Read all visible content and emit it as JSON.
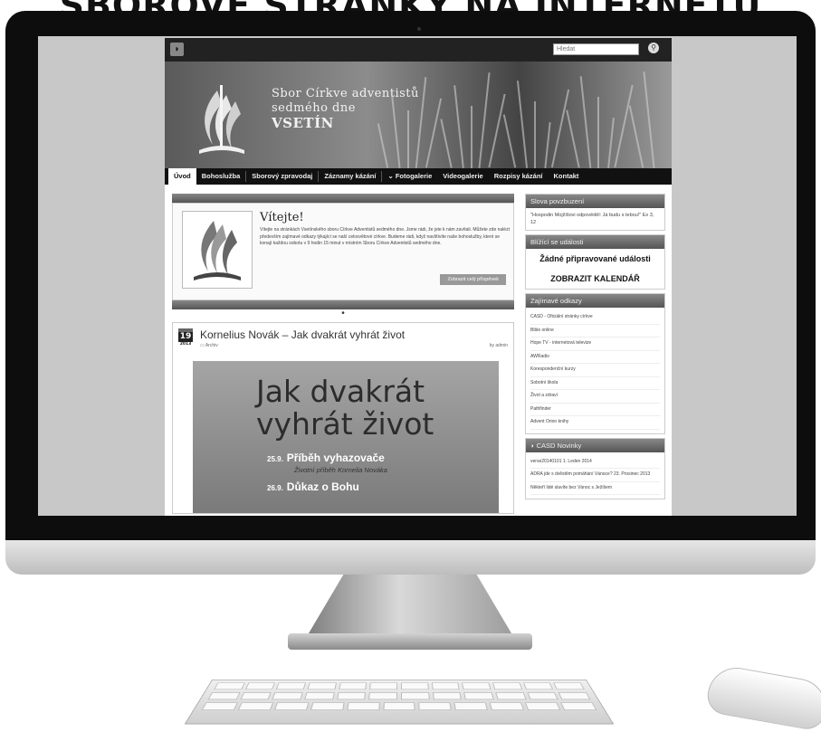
{
  "headline": "SBOROVÉ STRÁNKY NA INTERNETU",
  "site": {
    "search_placeholder": "Hledat",
    "church_line1": "Sbor Církve adventistů",
    "church_line2": "sedmého dne",
    "church_line3": "VSETÍN",
    "nav": [
      "Úvod",
      "Bohoslužba",
      "Sborový zpravodaj",
      "Záznamy kázání",
      "⌄ Fotogalerie",
      "Videogalerie",
      "Rozpisy kázání",
      "Kontakt"
    ],
    "welcome_title": "Vítejte!",
    "welcome_text": "Vítejte na stránkách Vsetínského sboru Církve Adventistů sedmého dne. Jsme rádi, že jste k nám zavítali. Můžete zde nalézt především zajímavé odkazy týkající se naší celosvětové církve. Budeme rádi, když navštívíte naše bohoslužby, které se konají každou sobotu v 9 hodin 15 minut v místním Sboru Církve Adventistů sedmého dne.",
    "welcome_button": "Zobrazit celý příspěvek",
    "post_day": "19",
    "post_year": "2013",
    "post_title": "Kornelius Novák – Jak dvakrát vyhrát život",
    "post_category": "Archiv",
    "post_author": "by admin",
    "poster_line1": "Jak dvakrát",
    "poster_line2": "vyhrát život",
    "poster_row1_date": "25.9.",
    "poster_row1_title": "Příběh vyhazovače",
    "poster_row1_sub": "Životní příběh Kornelia Nováka",
    "poster_row2_date": "26.9.",
    "poster_row2_title": "Důkaz o Bohu",
    "w1_title": "Slova povzbuzení",
    "w1_text": "\"Hospodin Mojžíšovi odpověděl: Já budu s tebou!\" Ex 3, 12",
    "w2_title": "Blížící se události",
    "w2_text1": "Žádné připravované události",
    "w2_text2": "ZOBRAZIT KALENDÁŘ",
    "w3_title": "Zajímavé odkazy",
    "w3_links": [
      "CASD - Oficiální stránky církve",
      "Bible online",
      "Hope TV - internetová televize",
      "AWRadio",
      "Korespondenční kurzy",
      "Sobotní škola",
      "Život a zdraví",
      "Pathfinder",
      "Advent Orion knihy"
    ],
    "w4_title": "CASD Novinky",
    "w4_items": [
      "verse20140101 1. Leden 2014",
      "ADRA jde s dvěstěm pomáhání Vánoce? 23. Prosinec 2013",
      "Někteří lidé slavíte bez Vánoc s Ježíšem"
    ]
  }
}
